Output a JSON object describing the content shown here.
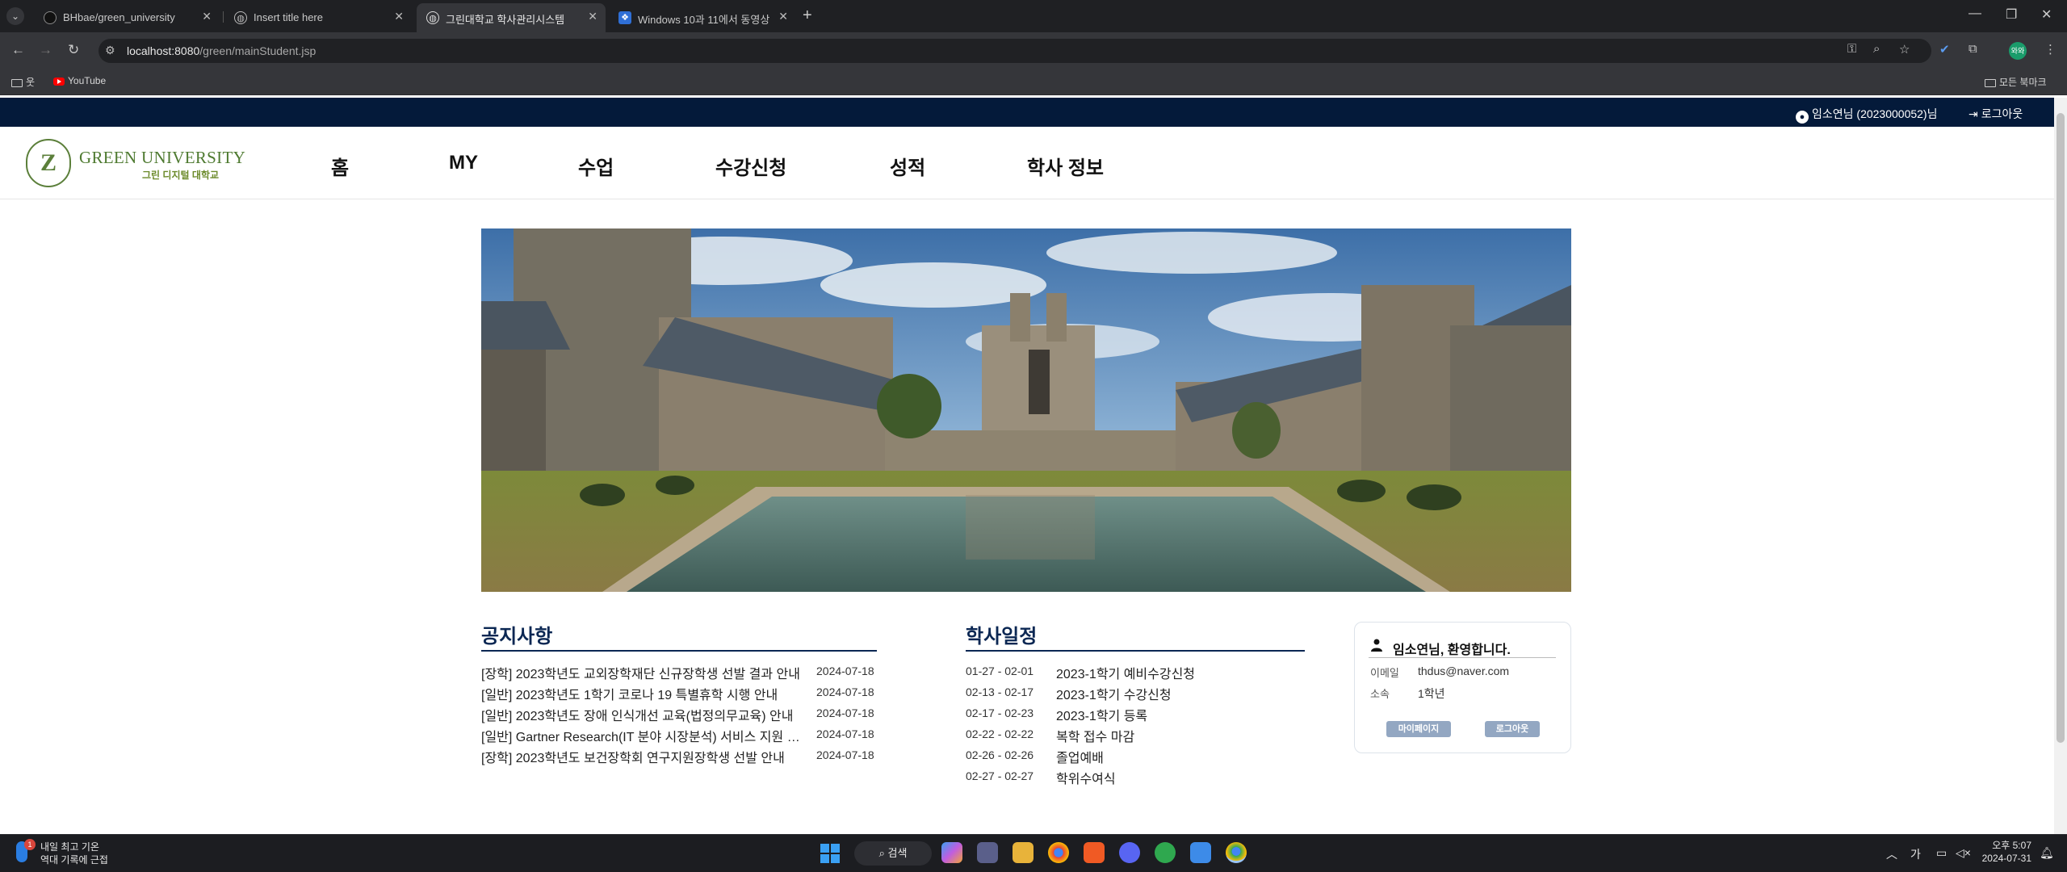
{
  "browser": {
    "tabs": [
      {
        "title": "BHbae/green_university",
        "active": false
      },
      {
        "title": "Insert title here",
        "active": false
      },
      {
        "title": "그린대학교 학사관리시스템",
        "active": true
      },
      {
        "title": "Windows 10과 11에서 동영상",
        "active": false
      }
    ],
    "url_host": "localhost:8080",
    "url_path": "/green/mainStudent.jsp",
    "bookmarks": [
      "웃",
      "YouTube"
    ],
    "all_bookmarks": "모든 북마크",
    "profile_initials": "와와"
  },
  "site": {
    "user_greeting": "임소연님 (2023000052)님",
    "logout_label": "로그아웃",
    "logo_name": "GREEN UNIVERSITY",
    "logo_sub": "그린 디지털 대학교",
    "logo_mark": "Z",
    "nav": [
      "홈",
      "MY",
      "수업",
      "수강신청",
      "성적",
      "학사 정보"
    ]
  },
  "notices": {
    "title": "공지사항",
    "items": [
      {
        "text": "[장학] 2023학년도 교외장학재단 신규장학생 선발 결과 안내",
        "date": "2024-07-18"
      },
      {
        "text": "[일반] 2023학년도 1학기 코로나 19 특별휴학 시행 안내",
        "date": "2024-07-18"
      },
      {
        "text": "[일반] 2023학년도 장애 인식개선 교육(법정의무교육) 안내",
        "date": "2024-07-18"
      },
      {
        "text": "[일반] Gartner Research(IT 분야 시장분석) 서비스 지원 안내",
        "date": "2024-07-18"
      },
      {
        "text": "[장학] 2023학년도 보건장학회 연구지원장학생 선발 안내",
        "date": "2024-07-18"
      }
    ]
  },
  "schedule": {
    "title": "학사일정",
    "items": [
      {
        "range": "01-27 - 02-01",
        "text": "2023-1학기 예비수강신청"
      },
      {
        "range": "02-13 - 02-17",
        "text": "2023-1학기 수강신청"
      },
      {
        "range": "02-17 - 02-23",
        "text": "2023-1학기 등록"
      },
      {
        "range": "02-22 - 02-22",
        "text": "복학 접수 마감"
      },
      {
        "range": "02-26 - 02-26",
        "text": "졸업예배"
      },
      {
        "range": "02-27 - 02-27",
        "text": "학위수여식"
      }
    ]
  },
  "profile_card": {
    "welcome": "임소연님, 환영합니다.",
    "email_label": "이메일",
    "email": "thdus@naver.com",
    "dept_label": "소속",
    "dept": "1학년",
    "mypage_button": "마이페이지",
    "logout_button": "로그아웃"
  },
  "taskbar": {
    "weather_line1": "내일 최고 기온",
    "weather_line2": "역대 기록에 근접",
    "weather_badge": "1",
    "search": "검색",
    "ime": "가",
    "time": "오후 5:07",
    "date": "2024-07-31"
  }
}
